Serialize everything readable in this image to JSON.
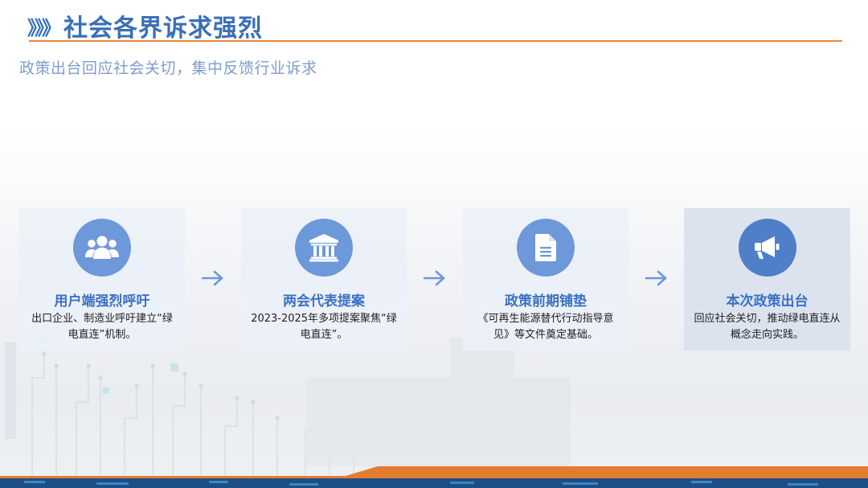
{
  "header": {
    "chevrons": "》》》",
    "title": "社会各界诉求强烈"
  },
  "subtitle": "政策出台回应社会关切，集中反馈行业诉求",
  "colors": {
    "accent_line": "#e8873c",
    "title_blue": "#3a6fb5",
    "icon_blue": "#6d98d9",
    "card_title_blue": "#3a71c4"
  },
  "steps": [
    {
      "icon": "users-icon",
      "title": "用户端强烈呼吁",
      "desc": "出口企业、制造业呼吁建立“绿电直连”机制。"
    },
    {
      "icon": "institution-icon",
      "title": "两会代表提案",
      "desc": "2023-2025年多项提案聚焦“绿电直连”。"
    },
    {
      "icon": "document-icon",
      "title": "政策前期铺垫",
      "desc": "《可再生能源替代行动指导意见》等文件奠定基础。"
    },
    {
      "icon": "megaphone-icon",
      "title": "本次政策出台",
      "desc": "回应社会关切，推动绿电直连从概念走向实践。"
    }
  ]
}
